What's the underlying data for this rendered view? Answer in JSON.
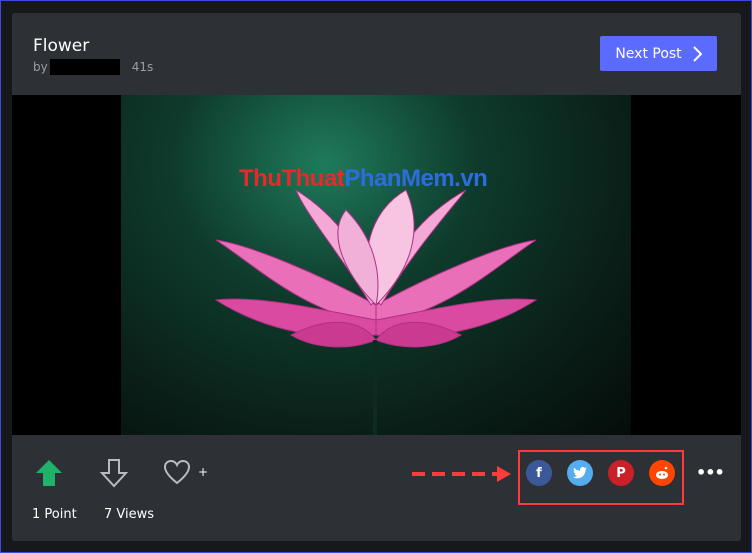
{
  "post": {
    "title": "Flower",
    "by_label": "by",
    "age": "41s"
  },
  "header": {
    "next_label": "Next Post"
  },
  "media": {
    "watermark_part1": "ThuThuat",
    "watermark_part2": "PhanMem.vn"
  },
  "footer": {
    "favorite_plus": "+",
    "points": "1 Point",
    "views": "7 Views",
    "share": [
      {
        "name": "facebook",
        "glyph": "f",
        "color": "#3b5998"
      },
      {
        "name": "twitter",
        "glyph": "t",
        "color": "#55acee"
      },
      {
        "name": "pinterest",
        "glyph": "P",
        "color": "#cb2027"
      },
      {
        "name": "reddit",
        "glyph": "r",
        "color": "#ff4500"
      }
    ],
    "more": "•••"
  }
}
